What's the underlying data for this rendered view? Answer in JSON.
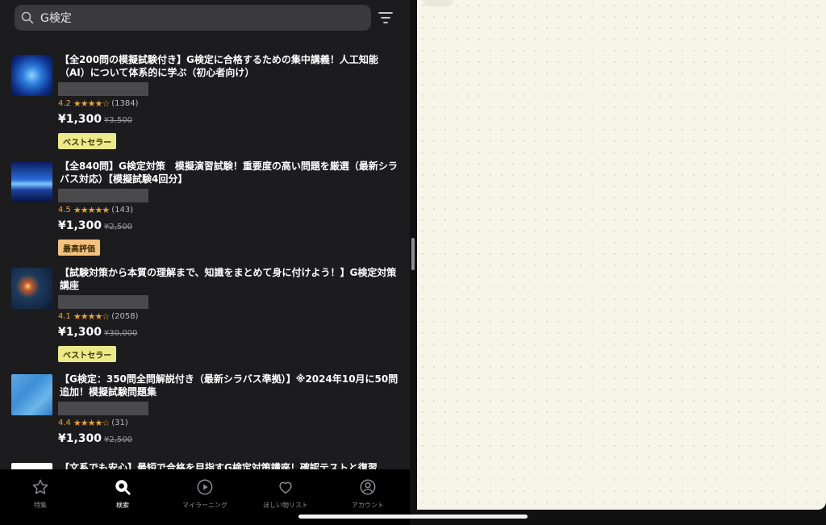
{
  "search": {
    "query": "G検定"
  },
  "courses": [
    {
      "title": "【全200問の模擬試験付き】G検定に合格するための集中講義！人工知能（AI）について体系的に学ぶ（初心者向け）",
      "rating": "4.2",
      "stars": "★★★★☆",
      "count": "(1384)",
      "price": "¥1,300",
      "original_price": "¥3,500",
      "badge": "ベストセラー"
    },
    {
      "title": "【全840問】G検定対策　模擬演習試験！重要度の高い問題を厳選（最新シラバス対応）【模擬試験4回分】",
      "rating": "4.5",
      "stars": "★★★★★",
      "count": "(143)",
      "price": "¥1,300",
      "original_price": "¥2,500",
      "badge": "最高評価"
    },
    {
      "title": "【試験対策から本質の理解まで、知識をまとめて身に付けよう！】G検定対策講座",
      "rating": "4.1",
      "stars": "★★★★☆",
      "count": "(2058)",
      "price": "¥1,300",
      "original_price": "¥30,000",
      "badge": "ベストセラー"
    },
    {
      "title": "【G検定：350問全問解説付き（最新シラバス準拠）】※2024年10月に50問追加！模擬試験問題集",
      "rating": "4.4",
      "stars": "★★★★☆",
      "count": "(31)",
      "price": "¥1,300",
      "original_price": "¥2,500",
      "badge": ""
    },
    {
      "title": "【文系でも安心】最短で合格を目指すG検定対策講座！確認テストと復習"
    }
  ],
  "tabs": [
    {
      "label": "特集"
    },
    {
      "label": "検索"
    },
    {
      "label": "マイラーニング"
    },
    {
      "label": "ほしい物リスト"
    },
    {
      "label": "アカウント"
    }
  ],
  "colors": {
    "accent_star": "#e8a33a",
    "badge_bestseller": "#ece98a",
    "badge_top_rated": "#f5c27e",
    "panel_bg": "#1c1c1e",
    "canvas_bg": "#f7f4e8"
  }
}
